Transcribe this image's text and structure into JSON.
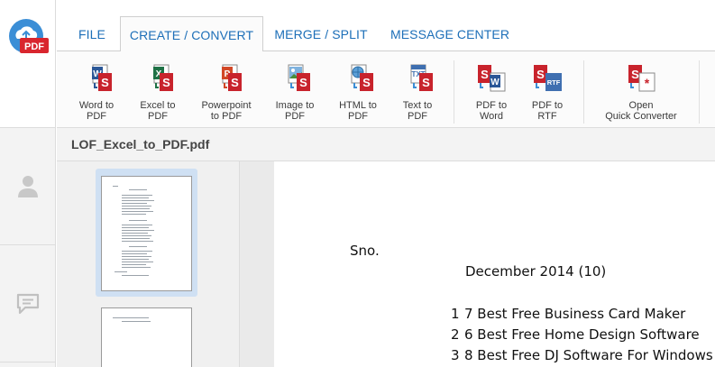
{
  "app": {
    "logo_text": "PDF"
  },
  "tabs": [
    {
      "label": "FILE",
      "active": false
    },
    {
      "label": "CREATE / CONVERT",
      "active": true
    },
    {
      "label": "MERGE / SPLIT",
      "active": false
    },
    {
      "label": "MESSAGE CENTER",
      "active": false
    }
  ],
  "ribbon": {
    "buttons": [
      {
        "line1": "Word to",
        "line2": "PDF",
        "icon": "word-to-pdf-icon"
      },
      {
        "line1": "Excel to",
        "line2": "PDF",
        "icon": "excel-to-pdf-icon"
      },
      {
        "line1": "Powerpoint",
        "line2": "to PDF",
        "icon": "powerpoint-to-pdf-icon"
      },
      {
        "line1": "Image to",
        "line2": "PDF",
        "icon": "image-to-pdf-icon"
      },
      {
        "line1": "HTML to",
        "line2": "PDF",
        "icon": "html-to-pdf-icon"
      },
      {
        "line1": "Text to",
        "line2": "PDF",
        "icon": "text-to-pdf-icon"
      },
      {
        "line1": "PDF to",
        "line2": "Word",
        "icon": "pdf-to-word-icon"
      },
      {
        "line1": "PDF to",
        "line2": "RTF",
        "icon": "pdf-to-rtf-icon"
      },
      {
        "line1": "Open",
        "line2": "Quick Converter",
        "icon": "quick-converter-icon"
      }
    ]
  },
  "document": {
    "filename": "LOF_Excel_to_PDF.pdf",
    "page_lines": [
      {
        "text": "Sno."
      },
      {
        "text": "December 2014 (10)"
      },
      {
        "num": "1",
        "text": "7 Best Free Business Card Maker"
      },
      {
        "num": "2",
        "text": "6 Best Free Home Design Software"
      },
      {
        "num": "3",
        "text": "8 Best Free DJ Software For Windows"
      }
    ]
  },
  "colors": {
    "accent": "#1d6fb8",
    "pdf_red": "#c8232c",
    "word_blue": "#2b5797",
    "excel_green": "#1e7145",
    "ppt_orange": "#d24726",
    "selection": "#cfe0f3"
  }
}
